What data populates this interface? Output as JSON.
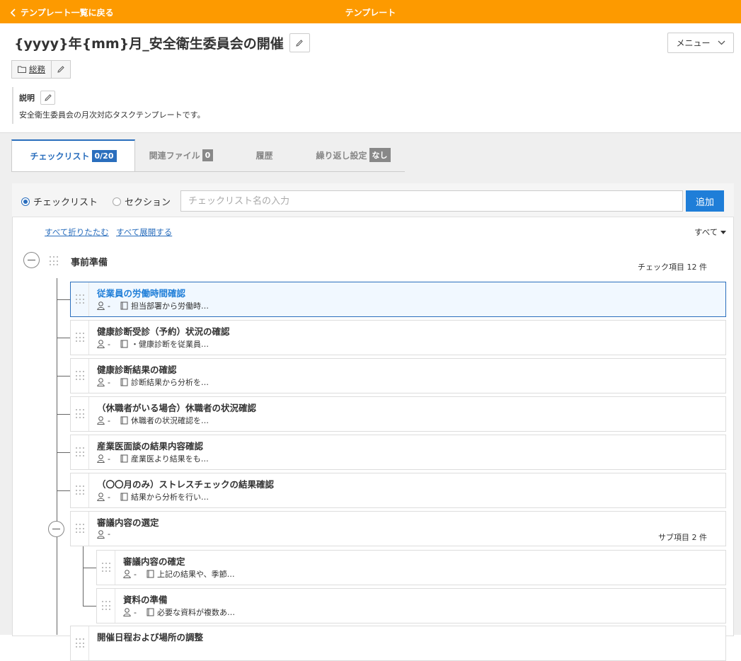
{
  "topbar": {
    "back_label": "テンプレート一覧に戻る",
    "title": "テンプレート"
  },
  "header": {
    "title": "{yyyy}年{mm}月_安全衛生委員会の開催",
    "menu_label": "メニュー",
    "category": "総務"
  },
  "description": {
    "label": "説明",
    "text": "安全衛生委員会の月次対応タスクテンプレートです。"
  },
  "tabs": [
    {
      "label": "チェックリスト",
      "badge": "0/20"
    },
    {
      "label": "関連ファイル",
      "badge": "0"
    },
    {
      "label": "履歴",
      "badge": ""
    },
    {
      "label": "繰り返し設定",
      "badge": "なし"
    }
  ],
  "entry": {
    "radio_checklist": "チェックリスト",
    "radio_section": "セクション",
    "selected": "checklist",
    "placeholder": "チェックリスト名の入力",
    "add_label": "追加"
  },
  "controls": {
    "collapse_all": "すべて折りたたむ",
    "expand_all": "すべて展開する",
    "filter": "すべて"
  },
  "section": {
    "title": "事前準備",
    "count": "チェック項目 12 件"
  },
  "items": [
    {
      "title": "従業員の労働時間確認",
      "assignee": "-",
      "note": "担当部署から労働時…"
    },
    {
      "title": "健康診断受診（予約）状況の確認",
      "assignee": "-",
      "note": "・健康診断を従業員…"
    },
    {
      "title": "健康診断結果の確認",
      "assignee": "-",
      "note": "診断結果から分析を…"
    },
    {
      "title": "（休職者がいる場合）休職者の状況確認",
      "assignee": "-",
      "note": "休職者の状況確認を…"
    },
    {
      "title": "産業医面談の結果内容確認",
      "assignee": "-",
      "note": "産業医より結果をも…"
    },
    {
      "title": "（〇〇月のみ）ストレスチェックの結果確認",
      "assignee": "-",
      "note": "結果から分析を行い…"
    },
    {
      "title": "審議内容の選定",
      "assignee": "-",
      "sub_count": "サブ項目 2 件"
    },
    {
      "title": "開催日程および場所の調整"
    }
  ],
  "subitems": [
    {
      "title": "審議内容の確定",
      "assignee": "-",
      "note": "上記の結果や、季節…"
    },
    {
      "title": "資料の準備",
      "assignee": "-",
      "note": "必要な資料が複数あ…"
    }
  ],
  "colors": {
    "topbar": "#fd9a00",
    "accent": "#2a6ebd",
    "button": "#1f7ed8"
  }
}
